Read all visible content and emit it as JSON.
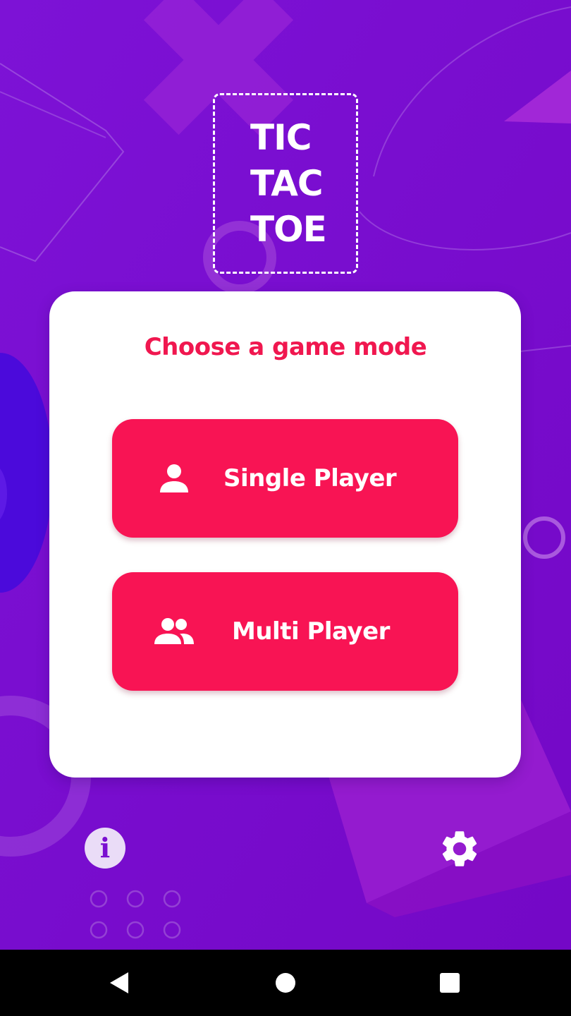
{
  "app": {
    "logo_lines": [
      "TIC",
      "TAC",
      "TOE"
    ]
  },
  "card": {
    "title": "Choose a game mode"
  },
  "modes": {
    "single": {
      "label": "Single Player",
      "icon": "person-icon"
    },
    "multi": {
      "label": "Multi Player",
      "icon": "people-icon"
    }
  },
  "footer": {
    "info_glyph": "i",
    "info_icon": "info-icon",
    "settings_icon": "gear-icon"
  },
  "navbar": {
    "back_icon": "back-triangle-icon",
    "home_icon": "home-circle-icon",
    "recents_icon": "recents-square-icon"
  },
  "colors": {
    "background": "#7a0fd0",
    "accent": "#f81454",
    "title": "#f0174f",
    "card": "#ffffff"
  }
}
